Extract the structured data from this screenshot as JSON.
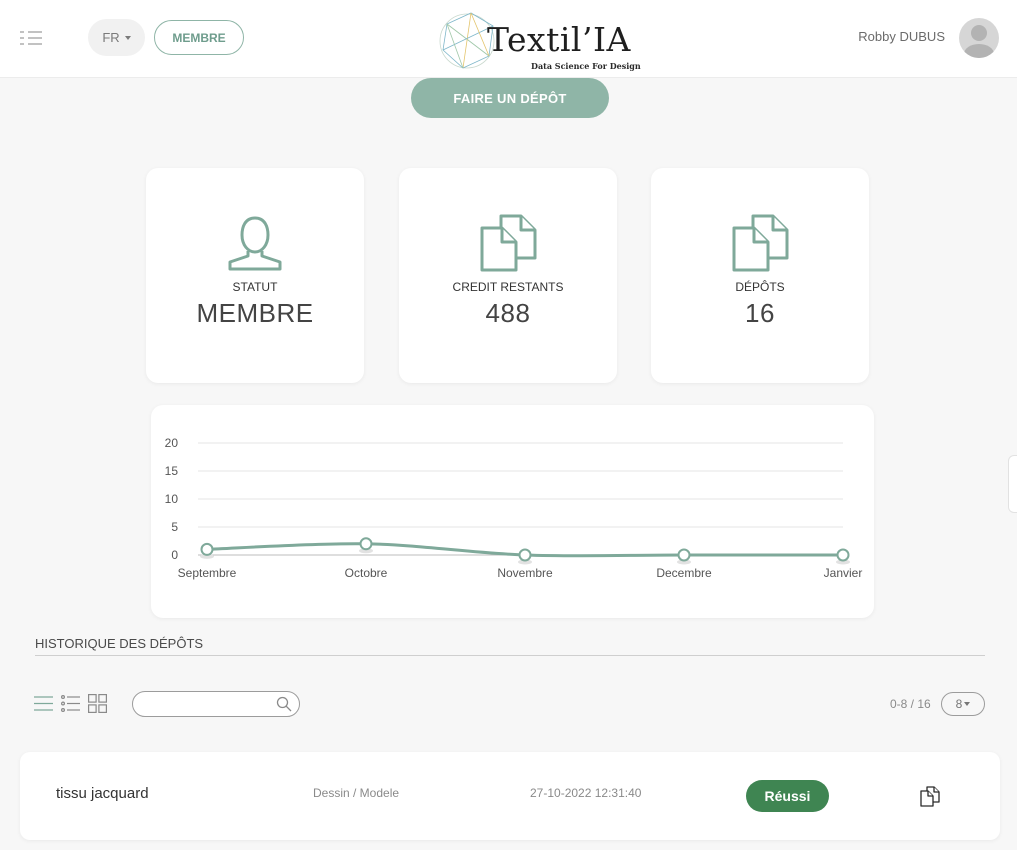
{
  "header": {
    "menu_icon": "list-menu-icon",
    "language": "FR",
    "role_button": "MEMBRE",
    "logo_text": "Textil’IA",
    "logo_tagline": "Data Science For Design",
    "user_name": "Robby DUBUS",
    "avatar_icon": "user-avatar-icon"
  },
  "actions": {
    "deposit_button": "FAIRE UN DÉPÔT"
  },
  "stats": [
    {
      "label": "STATUT",
      "value": "MEMBRE",
      "icon": "person-icon"
    },
    {
      "label": "CREDIT RESTANTS",
      "value": "488",
      "icon": "documents-icon"
    },
    {
      "label": "DÉPÔTS",
      "value": "16",
      "icon": "documents-icon"
    }
  ],
  "chart_data": {
    "type": "line",
    "categories": [
      "Septembre",
      "Octobre",
      "Novembre",
      "Decembre",
      "Janvier"
    ],
    "values": [
      1,
      2,
      0,
      0,
      0
    ],
    "ylim": [
      0,
      20
    ],
    "yticks": [
      "0",
      "5",
      "10",
      "15",
      "20"
    ],
    "grid": true,
    "color": "#7fa99a"
  },
  "history": {
    "title": "HISTORIQUE DES DÉPÔTS",
    "search_value": "",
    "pager": "0-8 / 16",
    "per_page": "8",
    "rows": [
      {
        "name": "tissu jacquard",
        "type": "Dessin / Modele",
        "date": "27-10-2022 12:31:40",
        "status": "Réussi"
      }
    ]
  },
  "colors": {
    "accent": "#8fb5a7",
    "success": "#3f8552"
  }
}
